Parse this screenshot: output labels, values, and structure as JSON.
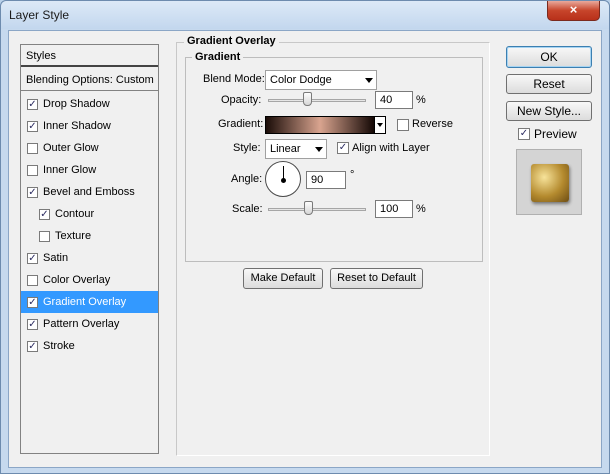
{
  "window": {
    "title": "Layer Style",
    "close_glyph": "×"
  },
  "styles_list": {
    "header": "Styles",
    "blending": "Blending Options: Custom",
    "items": [
      {
        "label": "Drop Shadow",
        "checked": true,
        "indent": false,
        "selected": false
      },
      {
        "label": "Inner Shadow",
        "checked": true,
        "indent": false,
        "selected": false
      },
      {
        "label": "Outer Glow",
        "checked": false,
        "indent": false,
        "selected": false
      },
      {
        "label": "Inner Glow",
        "checked": false,
        "indent": false,
        "selected": false
      },
      {
        "label": "Bevel and Emboss",
        "checked": true,
        "indent": false,
        "selected": false
      },
      {
        "label": "Contour",
        "checked": true,
        "indent": true,
        "selected": false
      },
      {
        "label": "Texture",
        "checked": false,
        "indent": true,
        "selected": false
      },
      {
        "label": "Satin",
        "checked": true,
        "indent": false,
        "selected": false
      },
      {
        "label": "Color Overlay",
        "checked": false,
        "indent": false,
        "selected": false
      },
      {
        "label": "Gradient Overlay",
        "checked": true,
        "indent": false,
        "selected": true
      },
      {
        "label": "Pattern Overlay",
        "checked": true,
        "indent": false,
        "selected": false
      },
      {
        "label": "Stroke",
        "checked": true,
        "indent": false,
        "selected": false
      }
    ]
  },
  "panel": {
    "title": "Gradient Overlay",
    "group": "Gradient",
    "blend_mode": {
      "label": "Blend Mode:",
      "value": "Color Dodge"
    },
    "opacity": {
      "label": "Opacity:",
      "value": "40",
      "unit": "%",
      "level": 40
    },
    "gradient": {
      "label": "Gradient:",
      "reverse_label": "Reverse",
      "reverse_checked": false
    },
    "style": {
      "label": "Style:",
      "value": "Linear",
      "align_label": "Align with Layer",
      "align_checked": true
    },
    "angle": {
      "label": "Angle:",
      "value": "90",
      "unit": "°"
    },
    "scale": {
      "label": "Scale:",
      "value": "100",
      "unit": "%",
      "level": 41
    },
    "make_default": "Make Default",
    "reset_default": "Reset to Default"
  },
  "right": {
    "ok": "OK",
    "reset": "Reset",
    "new_style": "New Style...",
    "preview_label": "Preview",
    "preview_checked": true
  },
  "colors": {
    "selected_bg": "#3399ff",
    "gradient_stops": [
      "#1a0c08",
      "#d9a48f",
      "#140805"
    ]
  }
}
